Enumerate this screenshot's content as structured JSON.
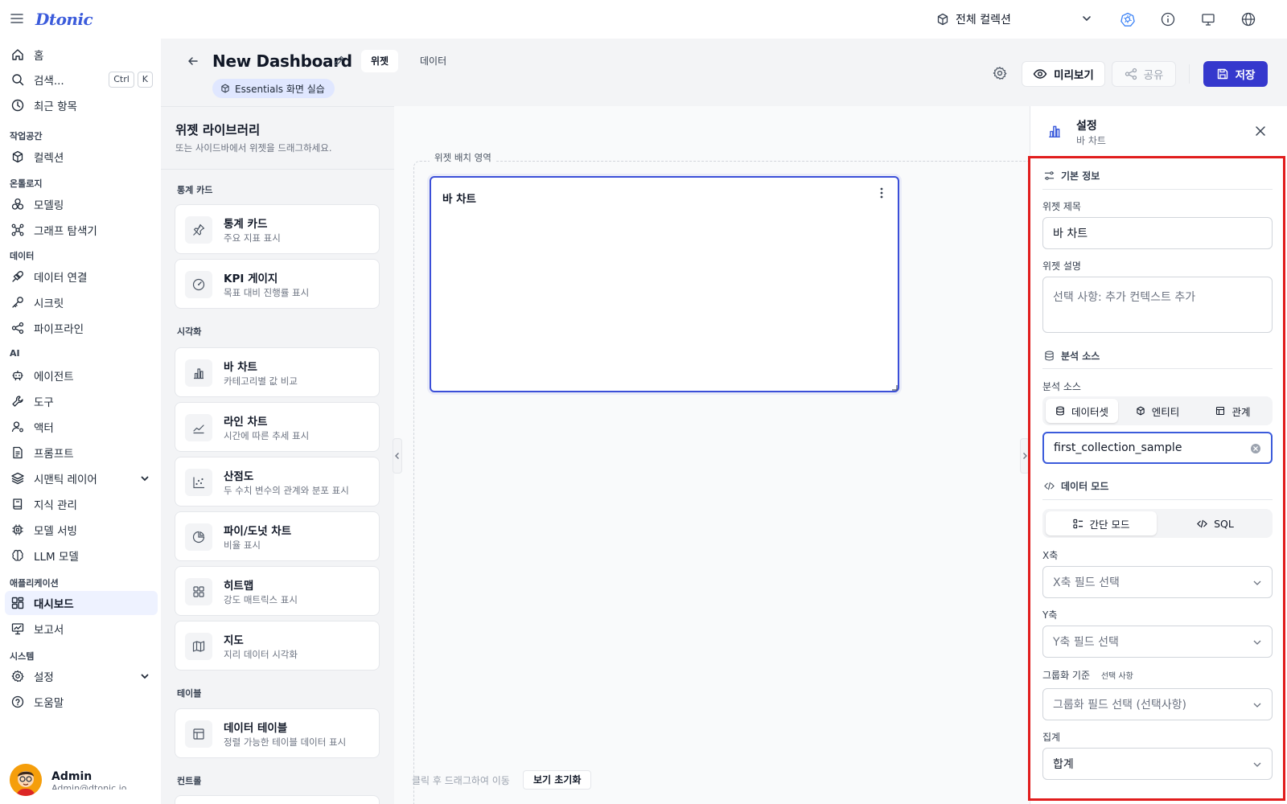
{
  "app": {
    "logo": "Dtonic"
  },
  "topbar": {
    "collection": "전체 컬렉션"
  },
  "sidebar": {
    "home": "홈",
    "search": "검색...",
    "search_kbd": [
      "Ctrl",
      "K"
    ],
    "recent": "최근 항목",
    "sec_workspace": "작업공간",
    "collection": "컬렉션",
    "sec_ontology": "온톨로지",
    "modeling": "모델링",
    "graph_explorer": "그래프 탐색기",
    "sec_data": "데이터",
    "data_connection": "데이터 연결",
    "secret": "시크릿",
    "pipeline": "파이프라인",
    "sec_ai": "AI",
    "agent": "에이전트",
    "tools": "도구",
    "actor": "액터",
    "prompt": "프롬프트",
    "semantic_layer": "시맨틱 레이어",
    "knowledge": "지식 관리",
    "model_serving": "모델 서빙",
    "llm_model": "LLM 모델",
    "sec_apps": "애플리케이션",
    "dashboard": "대시보드",
    "report": "보고서",
    "sec_system": "시스템",
    "settings": "설정",
    "help": "도움말",
    "user_name": "Admin",
    "user_email": "Admin@dtonic.io"
  },
  "header": {
    "title": "New Dashboard",
    "tab_widget": "위젯",
    "tab_data": "데이터",
    "badge": "Essentials 화면 실습",
    "preview": "미리보기",
    "share": "공유",
    "save": "저장"
  },
  "library": {
    "title": "위젯 라이브러리",
    "subtitle": "또는 사이드바에서 위젯을 드래그하세요.",
    "sec_stats": "통계 카드",
    "sec_viz": "시각화",
    "sec_table": "테이블",
    "sec_control": "컨트롤",
    "cards": [
      {
        "title": "통계 카드",
        "sub": "주요 지표 표시"
      },
      {
        "title": "KPI 게이지",
        "sub": "목표 대비 진행률 표시"
      },
      {
        "title": "바 차트",
        "sub": "카테고리별 값 비교"
      },
      {
        "title": "라인 차트",
        "sub": "시간에 따른 추세 표시"
      },
      {
        "title": "산점도",
        "sub": "두 수치 변수의 관계와 분포 표시"
      },
      {
        "title": "파이/도넛 차트",
        "sub": "비율 표시"
      },
      {
        "title": "히트맵",
        "sub": "강도 매트릭스 표시"
      },
      {
        "title": "지도",
        "sub": "지리 데이터 시각화"
      },
      {
        "title": "데이터 테이블",
        "sub": "정렬 가능한 테이블 데이터 표시"
      }
    ]
  },
  "canvas": {
    "drop_label": "위젯 배치 영역",
    "widget_title": "바 차트",
    "hint": "클릭 후 드래그하여 이동",
    "reset": "보기 초기화"
  },
  "settings": {
    "title": "설정",
    "subtitle": "바 차트",
    "sec_basic": "기본 정보",
    "widget_title_label": "위젯 제목",
    "widget_title_value": "바 차트",
    "widget_desc_label": "위젯 설명",
    "widget_desc_placeholder": "선택 사항: 추가 컨텍스트 추가",
    "sec_source": "분석 소스",
    "source_label": "분석 소스",
    "source_tabs": [
      "데이터셋",
      "엔티티",
      "관계"
    ],
    "source_value": "first_collection_sample",
    "sec_mode": "데이터 모드",
    "mode_tabs": [
      "간단 모드",
      "SQL"
    ],
    "x_label": "X축",
    "x_placeholder": "X축 필드 선택",
    "y_label": "Y축",
    "y_placeholder": "Y축 필드 선택",
    "group_label": "그룹화 기준",
    "group_optional": "선택 사항",
    "group_placeholder": "그룹화 필드 선택 (선택사항)",
    "agg_label": "집계",
    "agg_value": "합계"
  }
}
